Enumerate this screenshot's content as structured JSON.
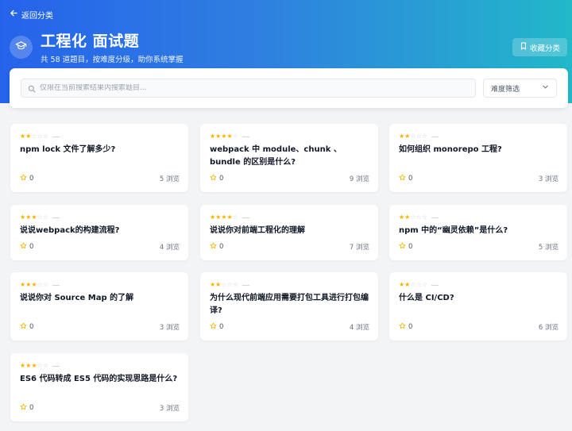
{
  "nav": {
    "back_label": "返回分类"
  },
  "header": {
    "title": "工程化 面试题",
    "subtitle": "共 58 道题目，按难度分级，助你系统掌握",
    "favorite_label": "收藏分类",
    "category_icon": "graduation-cap-icon"
  },
  "search": {
    "placeholder": "仅限在当前搜索结果内搜索题目...",
    "value": "",
    "difficulty_label": "难度筛选"
  },
  "colors": {
    "accent_start": "#2563eb",
    "accent_end": "#22b8c9",
    "star": "#f5b301"
  },
  "questions": [
    {
      "title": "npm lock 文件了解多少?",
      "difficulty": 2,
      "likes": "0",
      "views": "5 浏览"
    },
    {
      "title": "webpack 中 module、chunk 、bundle 的区别是什么?",
      "difficulty": 4,
      "likes": "0",
      "views": "9 浏览"
    },
    {
      "title": "如何组织 monorepo 工程?",
      "difficulty": 2,
      "likes": "0",
      "views": "3 浏览"
    },
    {
      "title": "说说webpack的构建流程?",
      "difficulty": 3,
      "likes": "0",
      "views": "4 浏览"
    },
    {
      "title": "说说你对前端工程化的理解",
      "difficulty": 4,
      "likes": "0",
      "views": "7 浏览"
    },
    {
      "title": "npm 中的“幽灵依赖”是什么?",
      "difficulty": 2,
      "likes": "0",
      "views": "5 浏览"
    },
    {
      "title": "说说你对 Source Map 的了解",
      "difficulty": 3,
      "likes": "0",
      "views": "3 浏览"
    },
    {
      "title": "为什么现代前端应用需要打包工具进行打包编译?",
      "difficulty": 2,
      "likes": "0",
      "views": "4 浏览"
    },
    {
      "title": "什么是 CI/CD?",
      "difficulty": 2,
      "likes": "0",
      "views": "6 浏览"
    },
    {
      "title": "ES6 代码转成 ES5 代码的实现思路是什么?",
      "difficulty": 3,
      "likes": "0",
      "views": "3 浏览"
    }
  ]
}
